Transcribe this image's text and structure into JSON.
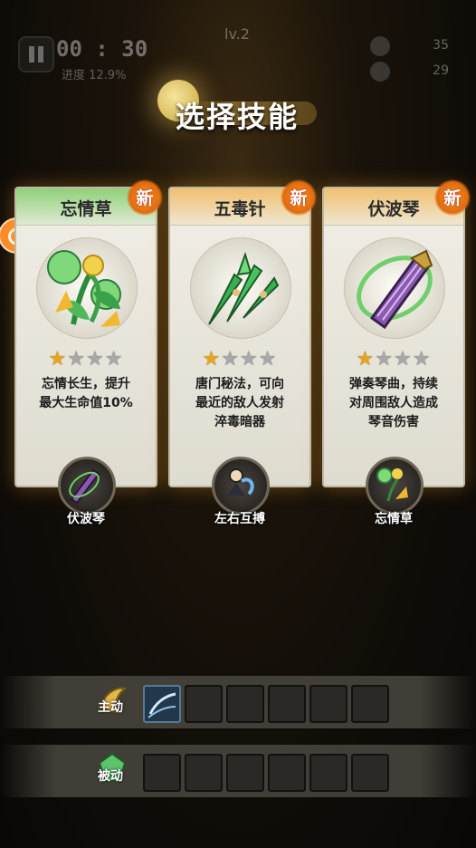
{
  "hud": {
    "timer": "00 : 30",
    "progress": "进度 12.9%",
    "level": "lv.2",
    "stat_top": "35",
    "stat_bottom": "29"
  },
  "title": "选择技能",
  "cards": [
    {
      "name": "忘情草",
      "badge": "新",
      "stars_filled": 1,
      "stars_total": 4,
      "desc_lines": [
        "忘情长生，提升",
        "最大生命值10%"
      ],
      "combo_label": "伏波琴",
      "combo_icon": "zither-icon",
      "art_icon": "herb-icon",
      "head_color": "#7dc36a"
    },
    {
      "name": "五毒针",
      "badge": "新",
      "stars_filled": 1,
      "stars_total": 4,
      "desc_lines": [
        "唐门秘法，可向",
        "最近的敌人发射",
        "淬毒暗器"
      ],
      "combo_label": "左右互搏",
      "combo_icon": "fighter-icon",
      "art_icon": "needles-icon",
      "head_color": "#e9b354"
    },
    {
      "name": "伏波琴",
      "badge": "新",
      "stars_filled": 1,
      "stars_total": 4,
      "desc_lines": [
        "弹奏琴曲，持续",
        "对周围敌人造成",
        "琴音伤害"
      ],
      "combo_label": "忘情草",
      "combo_icon": "herb-icon",
      "art_icon": "zither-icon",
      "head_color": "#e9b354"
    }
  ],
  "bars": {
    "active_label": "主动",
    "passive_label": "被动",
    "active_slots": 6,
    "passive_slots": 6,
    "active_filled_icon": "sword-slash-icon"
  },
  "colors": {
    "accent": "#f0a020",
    "new_badge": "#e06a10"
  }
}
